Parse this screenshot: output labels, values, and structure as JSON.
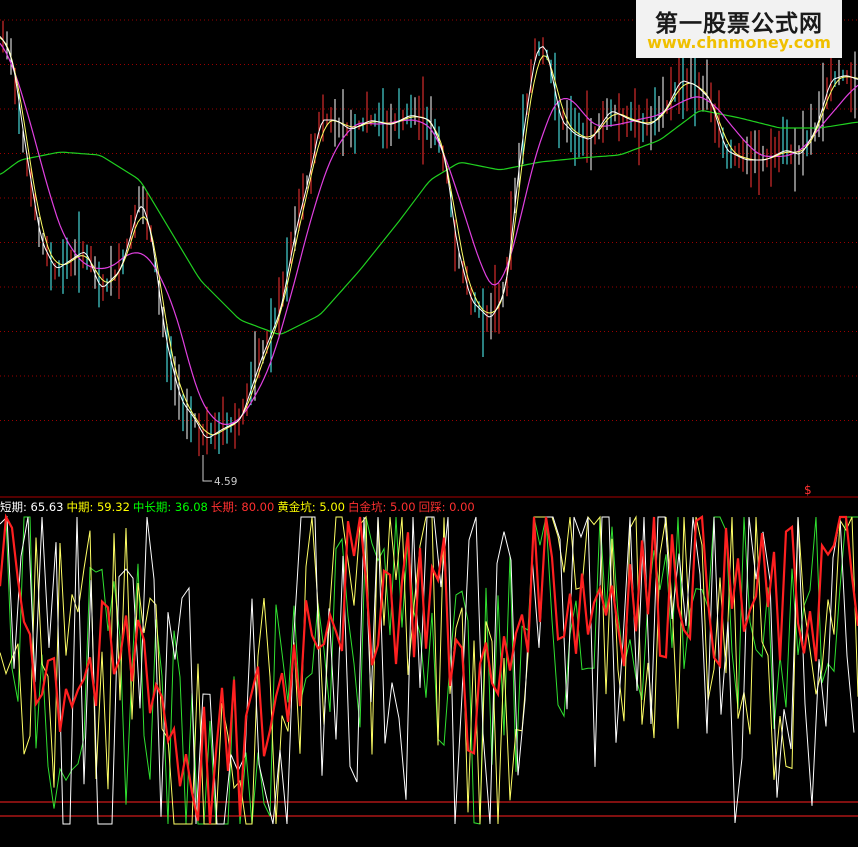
{
  "watermark": {
    "site_name": "第一股票公式网",
    "url": "www.chnmoney.com"
  },
  "price_panel": {
    "low_label": "4.59",
    "colors": {
      "bg": "#000000",
      "grid": "#9a0000",
      "up_bar": "#ff3333",
      "down_bar": "#54ffff",
      "flat_bar": "#ffffff",
      "ma_short": "#ffffff",
      "ma_mid": "#ffff66",
      "ma_long": "#e040e0",
      "ma_longest": "#20d020"
    }
  },
  "indicator_panel": {
    "legend": [
      {
        "label": "短期:",
        "value": "65.63",
        "color": "#ffffff"
      },
      {
        "label": "中期:",
        "value": "59.32",
        "color": "#ffff00"
      },
      {
        "label": "中长期:",
        "value": "36.08",
        "color": "#00ff00"
      },
      {
        "label": "长期:",
        "value": "80.00",
        "color": "#ff3030"
      },
      {
        "label": "黄金坑:",
        "value": "5.00",
        "color": "#ffff00"
      },
      {
        "label": "白金坑:",
        "value": "5.00",
        "color": "#ff3030"
      },
      {
        "label": "回踩:",
        "value": "0.00",
        "color": "#ff3030"
      }
    ],
    "marker_symbol": "$",
    "colors": {
      "short": "#ffffff",
      "mid": "#ffff66",
      "midlong": "#30e030",
      "long": "#ff2020",
      "ref_line": "#ff2020"
    }
  },
  "chart_data": {
    "type": "line",
    "series": [
      {
        "name": "短期",
        "last": 65.63
      },
      {
        "name": "中期",
        "last": 59.32
      },
      {
        "name": "中长期",
        "last": 36.08
      },
      {
        "name": "长期",
        "last": 80.0
      },
      {
        "name": "黄金坑",
        "last": 5.0
      },
      {
        "name": "白金坑",
        "last": 5.0
      },
      {
        "name": "回踩",
        "last": 0.0
      }
    ],
    "price_low_annotation": 4.59,
    "ylim_indicator": [
      0,
      100
    ]
  }
}
